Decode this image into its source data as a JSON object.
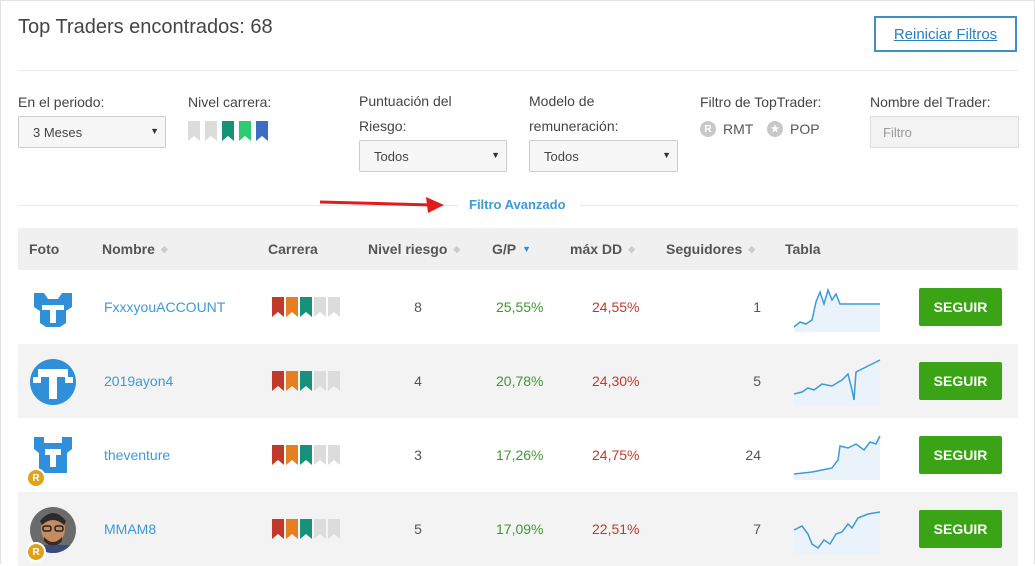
{
  "header": {
    "title": "Top Traders encontrados: 68",
    "reset_button": "Reiniciar Filtros"
  },
  "filters": {
    "period_label": "En el periodo:",
    "period_value": "3 Meses",
    "career_label": "Nivel carrera:",
    "risk_label_line1": "Puntuación del",
    "risk_label_line2": "Riesgo:",
    "risk_value": "Todos",
    "remun_label_line1": "Modelo de",
    "remun_label_line2": "remuneración:",
    "remun_value": "Todos",
    "toptrader_label": "Filtro de TopTrader:",
    "rmt_label": "RMT",
    "pop_label": "POP",
    "name_label": "Nombre del Trader:",
    "name_placeholder": "Filtro",
    "advanced_link": "Filtro Avanzado",
    "career_colors": [
      "#dcdcdc",
      "#dcdcdc",
      "#17917a",
      "#2ecc71",
      "#3a6fc4"
    ]
  },
  "table": {
    "headers": {
      "photo": "Foto",
      "name": "Nombre",
      "career": "Carrera",
      "risk": "Nivel riesgo",
      "gp": "G/P",
      "maxdd": "máx DD",
      "followers": "Seguidores",
      "chart": "Tabla"
    },
    "rows": [
      {
        "name": "FxxxyouACCOUNT",
        "risk": "8",
        "gp": "25,55%",
        "maxdd": "24,55%",
        "followers": "1",
        "follow": "SEGUIR",
        "badge": ""
      },
      {
        "name": "2019ayon4",
        "risk": "4",
        "gp": "20,78%",
        "maxdd": "24,30%",
        "followers": "5",
        "follow": "SEGUIR",
        "badge": ""
      },
      {
        "name": "theventure",
        "risk": "3",
        "gp": "17,26%",
        "maxdd": "24,75%",
        "followers": "24",
        "follow": "SEGUIR",
        "badge": "R"
      },
      {
        "name": "MMAM8",
        "risk": "5",
        "gp": "17,09%",
        "maxdd": "22,51%",
        "followers": "7",
        "follow": "SEGUIR",
        "badge": "R"
      }
    ],
    "career_colors": [
      "#c0392b",
      "#e67e22",
      "#17917a",
      "#dcdcdc",
      "#dcdcdc"
    ],
    "colors": {
      "accent": "#3d9ad6",
      "follow_green": "#3aa416",
      "gain_green": "#3a9a2f",
      "dd_red": "#c0392b"
    }
  }
}
